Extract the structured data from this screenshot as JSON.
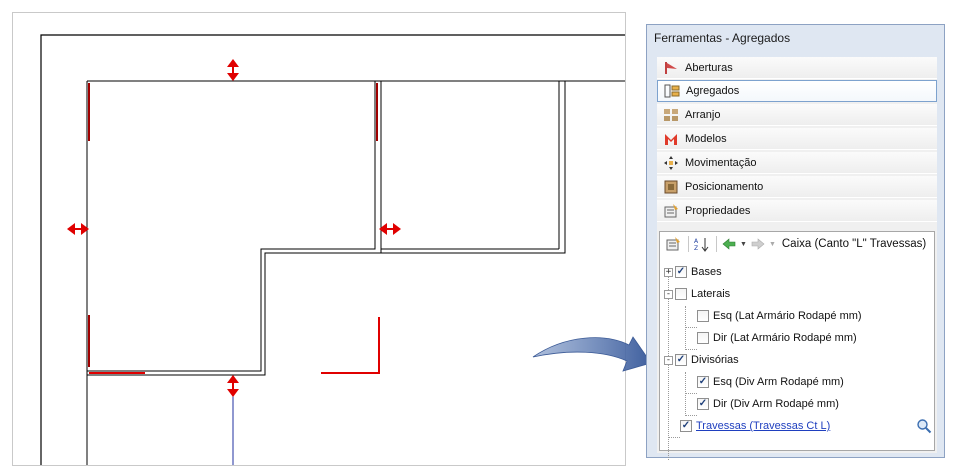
{
  "panel": {
    "title": "Ferramentas - Agregados",
    "menu": [
      {
        "label": "Aberturas",
        "icon": "opening-icon",
        "selected": false
      },
      {
        "label": "Agregados",
        "icon": "aggregate-icon",
        "selected": true
      },
      {
        "label": "Arranjo",
        "icon": "arrangement-icon",
        "selected": false
      },
      {
        "label": "Modelos",
        "icon": "models-icon",
        "selected": false
      },
      {
        "label": "Movimentação",
        "icon": "move-icon",
        "selected": false
      },
      {
        "label": "Posicionamento",
        "icon": "positioning-icon",
        "selected": false
      },
      {
        "label": "Propriedades",
        "icon": "properties-icon",
        "selected": false
      }
    ],
    "tree": {
      "toolbar_title": "Caixa (Canto \"L\" Travessas)",
      "nodes": [
        {
          "label": "Bases",
          "expander": "+",
          "checked": true
        },
        {
          "label": "Laterais",
          "expander": "-",
          "checked": false
        },
        {
          "label": "Esq (Lat Armário Rodapé mm)",
          "checked": false
        },
        {
          "label": "Dir (Lat Armário Rodapé mm)",
          "checked": false
        },
        {
          "label": "Divisórias",
          "expander": "-",
          "checked": true
        },
        {
          "label": "Esq (Div Arm Rodapé mm)",
          "checked": true
        },
        {
          "label": "Dir (Div Arm Rodapé mm)",
          "checked": true
        },
        {
          "label": "Travessas (Travessas Ct L)",
          "checked": true,
          "link": true
        }
      ]
    }
  },
  "colors": {
    "accent_red": "#e00000",
    "dark_red": "#a00000",
    "arrow_blue": "#4a6aa8",
    "guide_blue": "#2030a0"
  }
}
